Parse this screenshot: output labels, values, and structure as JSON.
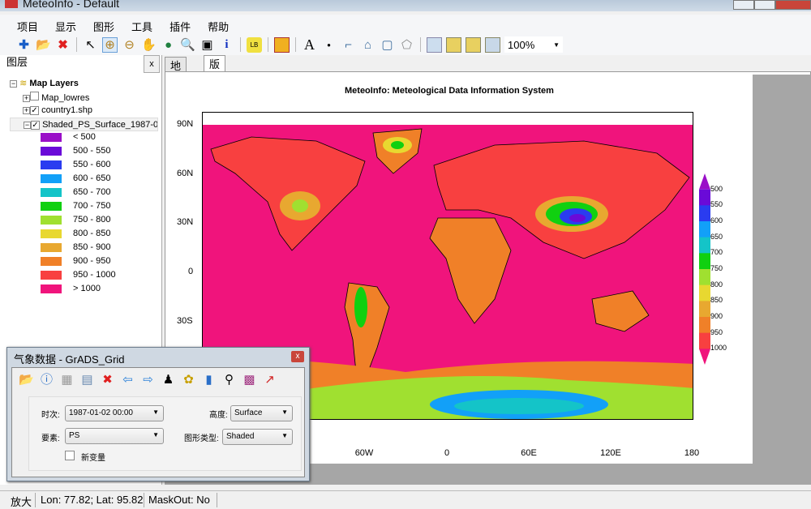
{
  "window": {
    "title": "MeteoInfo - Default"
  },
  "menu": [
    "项目",
    "显示",
    "图形",
    "工具",
    "插件",
    "帮助"
  ],
  "toolbar": {
    "icons": [
      "add-layer-icon",
      "open-folder-icon",
      "remove-icon",
      "pointer-icon",
      "zoom-in-icon",
      "zoom-out-icon",
      "pan-hand-icon",
      "globe-icon",
      "magnifier-icon",
      "zoom-extent-icon",
      "info-icon",
      "label-icon",
      "save-icon",
      "text-icon",
      "point-icon",
      "polyline-icon",
      "curve-polygon-icon",
      "rectangle-icon",
      "polygon-icon",
      "page-setup-icon",
      "page-zoom-in-icon",
      "page-zoom-out-icon",
      "page-fit-icon"
    ],
    "zoom": "100%"
  },
  "layers_panel": {
    "title": "图层",
    "close": "x",
    "root": "Map Layers",
    "layers": [
      {
        "name": "Map_lowres",
        "checked": false
      },
      {
        "name": "country1.shp",
        "checked": true
      },
      {
        "name": "Shaded_PS_Surface_1987-0",
        "checked": true
      }
    ],
    "legend": [
      {
        "label": "< 500",
        "color": "#9a0fc8"
      },
      {
        "label": "500 - 550",
        "color": "#6a0ad8"
      },
      {
        "label": "550 - 600",
        "color": "#2a3cf0"
      },
      {
        "label": "600 - 650",
        "color": "#12a0f8"
      },
      {
        "label": "650 - 700",
        "color": "#14c4c8"
      },
      {
        "label": "700 - 750",
        "color": "#10d010"
      },
      {
        "label": "750 - 800",
        "color": "#a0e030"
      },
      {
        "label": "800 - 850",
        "color": "#e8d830"
      },
      {
        "label": "850 - 900",
        "color": "#e8a830"
      },
      {
        "label": "900 - 950",
        "color": "#f08028"
      },
      {
        "label": "950 - 1000",
        "color": "#f84040"
      },
      {
        "label": "> 1000",
        "color": "#f0147c"
      }
    ]
  },
  "tabs": [
    {
      "label": "地图",
      "active": false
    },
    {
      "label": "版面",
      "active": true
    }
  ],
  "map": {
    "title": "MeteoInfo: Meteological Data Information System",
    "y_ticks": [
      "90N",
      "60N",
      "30N",
      "0",
      "30S"
    ],
    "x_ticks": [
      "60W",
      "0",
      "60E",
      "120E",
      "180"
    ],
    "colorbar": [
      "500",
      "550",
      "600",
      "650",
      "700",
      "750",
      "800",
      "850",
      "900",
      "950",
      "1000"
    ]
  },
  "dialog": {
    "title": "气象数据 - GrADS_Grid",
    "close": "x",
    "time_label": "时次:",
    "time_value": "1987-01-02 00:00",
    "level_label": "高度:",
    "level_value": "Surface",
    "var_label": "要素:",
    "var_value": "PS",
    "type_label": "图形类型:",
    "type_value": "Shaded",
    "new_var_label": "新变量",
    "new_var_checked": false
  },
  "status": {
    "mode": "放大",
    "coords": "Lon: 77.82; Lat: 95.82",
    "mask": "MaskOut: No"
  }
}
